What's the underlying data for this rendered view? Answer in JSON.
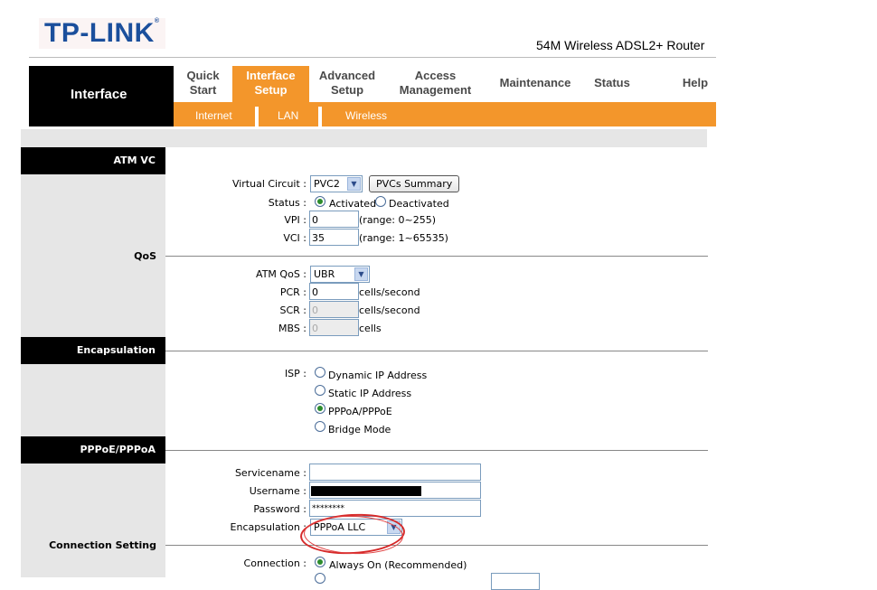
{
  "brand": {
    "logo": "TP-LINK",
    "trademark": "®",
    "model": "54M Wireless ADSL2+ Router"
  },
  "section_title": "Interface",
  "nav": {
    "items": [
      {
        "line1": "Quick",
        "line2": "Start"
      },
      {
        "line1": "Interface",
        "line2": "Setup"
      },
      {
        "line1": "Advanced",
        "line2": "Setup"
      },
      {
        "line1": "Access",
        "line2": "Management"
      },
      {
        "line1": "Maintenance",
        "line2": ""
      },
      {
        "line1": "Status",
        "line2": ""
      },
      {
        "line1": "Help",
        "line2": ""
      }
    ],
    "active": "Interface Setup"
  },
  "subnav": {
    "items": [
      "Internet",
      "LAN",
      "Wireless"
    ]
  },
  "sections": {
    "atm_vc": "ATM VC",
    "qos": "QoS",
    "encapsulation": "Encapsulation",
    "pppoe": "PPPoE/PPPoA",
    "connection_setting": "Connection Setting"
  },
  "form": {
    "virtual_circuit": {
      "label": "Virtual Circuit :",
      "value": "PVC2",
      "button": "PVCs Summary"
    },
    "status": {
      "label": "Status :",
      "opt1": "Activated",
      "opt2": "Deactivated",
      "selected": "Activated"
    },
    "vpi": {
      "label": "VPI :",
      "value": "0",
      "hint": "(range: 0~255)"
    },
    "vci": {
      "label": "VCI :",
      "value": "35",
      "hint": "(range: 1~65535)"
    },
    "atm_qos": {
      "label": "ATM QoS :",
      "value": "UBR"
    },
    "pcr": {
      "label": "PCR :",
      "value": "0",
      "unit": "cells/second"
    },
    "scr": {
      "label": "SCR :",
      "value": "0",
      "unit": "cells/second"
    },
    "mbs": {
      "label": "MBS :",
      "value": "0",
      "unit": "cells"
    },
    "isp": {
      "label": "ISP :",
      "options": [
        "Dynamic IP Address",
        "Static IP Address",
        "PPPoA/PPPoE",
        "Bridge Mode"
      ],
      "selected": "PPPoA/PPPoE"
    },
    "servicename": {
      "label": "Servicename :",
      "value": ""
    },
    "username": {
      "label": "Username :"
    },
    "password": {
      "label": "Password :",
      "value": "********"
    },
    "encapsulation": {
      "label": "Encapsulation :",
      "value": "PPPoA LLC"
    },
    "connection": {
      "label": "Connection :",
      "opt1": "Always On (Recommended)",
      "selected": "Always On (Recommended)"
    }
  },
  "colors": {
    "accent": "#f3962b",
    "header_bg": "#000000",
    "panel_gray": "#e6e6e6",
    "logo_blue": "#1b4f9c",
    "annotation_red": "#d62a2a"
  }
}
